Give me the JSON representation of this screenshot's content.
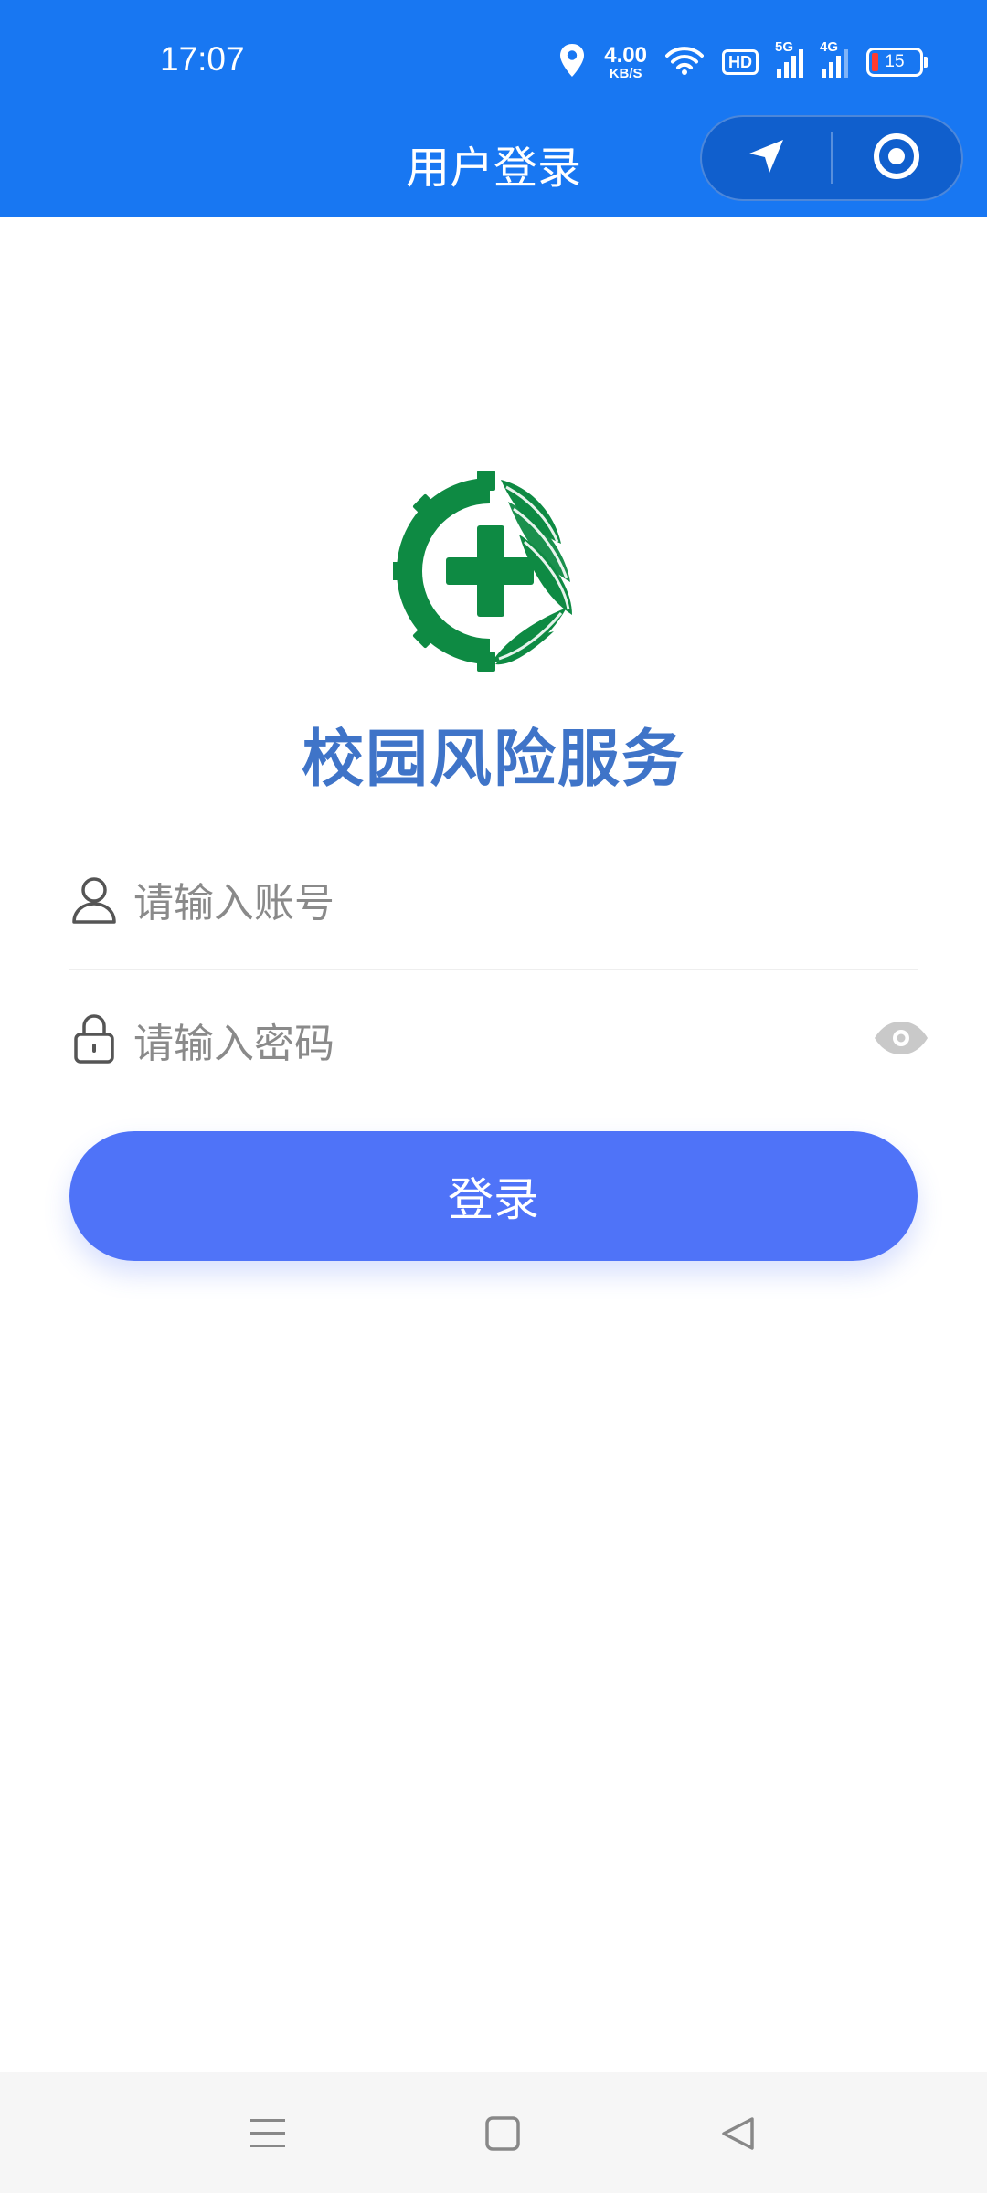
{
  "status_bar": {
    "time": "17:07",
    "net_speed_value": "4.00",
    "net_speed_unit": "KB/S",
    "hd_label": "HD",
    "signal1_label": "5G",
    "signal2_label": "4G",
    "battery_level": "15"
  },
  "header": {
    "title": "用户登录"
  },
  "brand": {
    "app_name": "校园风险服务"
  },
  "form": {
    "account_placeholder": "请输入账号",
    "password_placeholder": "请输入密码",
    "login_label": "登录"
  },
  "colors": {
    "header_bg": "#1877f2",
    "logo_green": "#0e8a43",
    "brand_text": "#3f74c8",
    "button_bg": "#4f73f8"
  },
  "icons": [
    "location-pin-icon",
    "wifi-icon",
    "hd-icon",
    "signal-icon",
    "battery-icon",
    "navigate-arrow-icon",
    "target-circle-icon",
    "user-icon",
    "lock-icon",
    "eye-icon",
    "menu-icon",
    "home-square-icon",
    "back-triangle-icon"
  ]
}
